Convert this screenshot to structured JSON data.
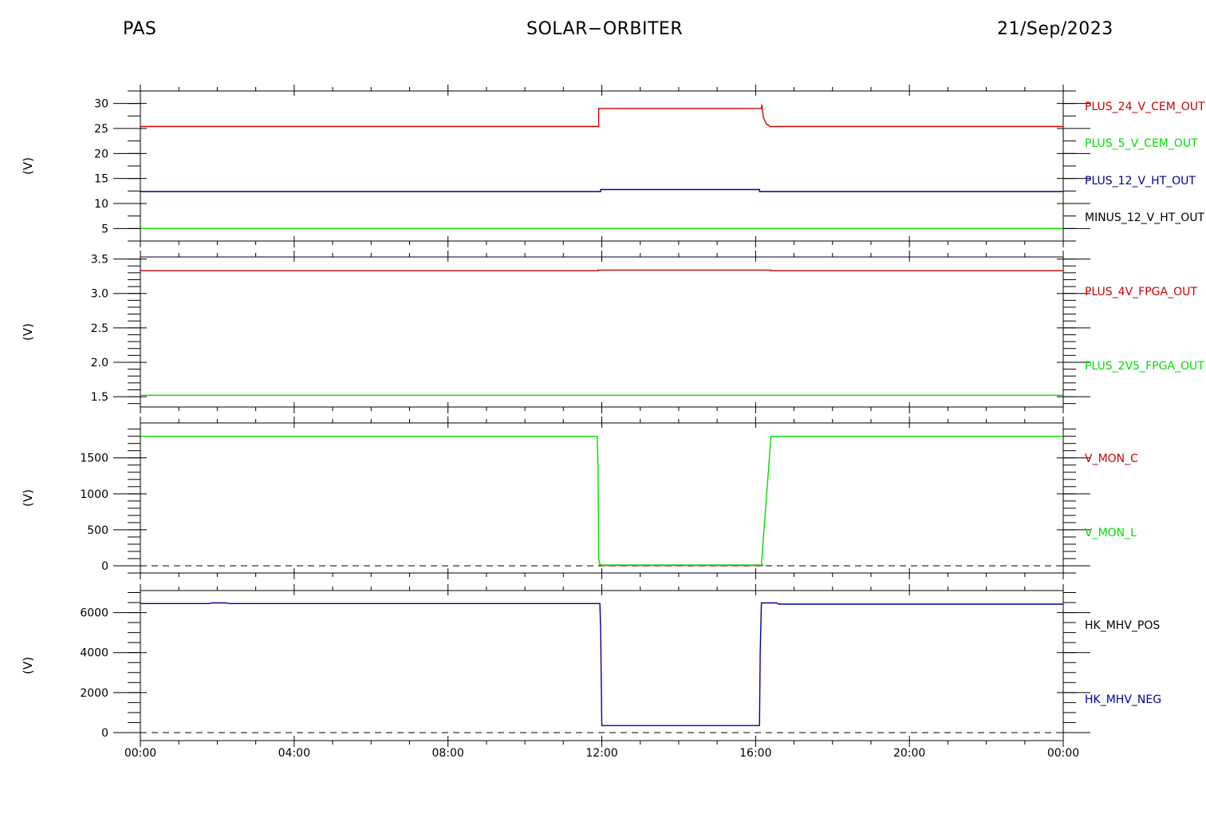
{
  "header": {
    "left": "PAS",
    "center": "SOLAR−ORBITER",
    "right": "21/Sep/2023"
  },
  "chart_data": [
    {
      "type": "line",
      "ylabel": "(V)",
      "ylim": [
        2.5,
        32.5
      ],
      "yticks": [
        5,
        10,
        15,
        20,
        25,
        30
      ],
      "ytick_labels": [
        "5",
        "10",
        "15",
        "20",
        "25",
        "30"
      ],
      "x_unit": "hours",
      "xlim": [
        0,
        24
      ],
      "legend_placement": "right",
      "series": [
        {
          "name": "PLUS_24_V_CEM_OUT",
          "color": "#cc0000",
          "x": [
            0,
            11.92,
            11.92,
            16.15,
            16.16,
            16.2,
            16.28,
            16.38,
            24
          ],
          "y": [
            25.4,
            25.4,
            29.0,
            29.0,
            29.8,
            27.2,
            25.9,
            25.4,
            25.4
          ]
        },
        {
          "name": "PLUS_5_V_CEM_OUT",
          "color": "#00dd00",
          "x": [
            0,
            24
          ],
          "y": [
            5.0,
            5.0
          ]
        },
        {
          "name": "PLUS_12_V_HT_OUT",
          "color": "#000099",
          "x": [
            0,
            11.97,
            11.97,
            16.1,
            16.1,
            24
          ],
          "y": [
            12.4,
            12.4,
            12.8,
            12.8,
            12.4,
            12.4
          ]
        },
        {
          "name": "MINUS_12_V_HT_OUT",
          "color": "#000000",
          "x": [],
          "y": []
        }
      ]
    },
    {
      "type": "line",
      "ylabel": "(V)",
      "ylim": [
        1.35,
        3.53
      ],
      "yticks": [
        1.5,
        2.0,
        2.5,
        3.0,
        3.5
      ],
      "ytick_labels": [
        "1.5",
        "2.0",
        "2.5",
        "3.0",
        "3.5"
      ],
      "x_unit": "hours",
      "xlim": [
        0,
        24
      ],
      "legend_placement": "right",
      "series": [
        {
          "name": "PLUS_4V_FPGA_OUT",
          "color": "#cc0000",
          "x": [
            0,
            11.9,
            11.9,
            16.4,
            16.4,
            24
          ],
          "y": [
            3.33,
            3.33,
            3.34,
            3.34,
            3.33,
            3.33
          ]
        },
        {
          "name": "PLUS_2V5_FPGA_OUT",
          "color": "#00dd00",
          "x": [
            0,
            24
          ],
          "y": [
            1.52,
            1.52
          ]
        }
      ]
    },
    {
      "type": "line",
      "ylabel": "(V)",
      "ylim": [
        -100,
        1985
      ],
      "yticks": [
        0,
        500,
        1000,
        1500
      ],
      "ytick_labels": [
        "0",
        "500",
        "1000",
        "1500"
      ],
      "x_unit": "hours",
      "xlim": [
        0,
        24
      ],
      "zero_line": 0,
      "legend_placement": "right",
      "series": [
        {
          "name": "V_MON_C",
          "color": "#cc0000",
          "x": [
            11.92,
            12.0,
            16.1,
            16.2
          ],
          "y": [
            5,
            5,
            5,
            5
          ]
        },
        {
          "name": "V_MON_L",
          "color": "#00dd00",
          "x": [
            0,
            11.88,
            11.9,
            11.92,
            11.95,
            12.0,
            16.1,
            16.15,
            16.4,
            16.42,
            24
          ],
          "y": [
            1800,
            1800,
            1400,
            100,
            20,
            10,
            10,
            10,
            1800,
            1800,
            1800
          ]
        }
      ]
    },
    {
      "type": "line",
      "ylabel": "(V)",
      "ylim": [
        -400,
        7100
      ],
      "yticks": [
        0,
        2000,
        4000,
        6000
      ],
      "ytick_labels": [
        "0",
        "2000",
        "4000",
        "6000"
      ],
      "x_unit": "hours",
      "xlim": [
        0,
        24
      ],
      "zero_line": 0,
      "xticks": [
        0,
        4,
        8,
        12,
        16,
        20,
        24
      ],
      "xtick_labels": [
        "00:00",
        "04:00",
        "08:00",
        "12:00",
        "16:00",
        "20:00",
        "00:00"
      ],
      "legend_placement": "right",
      "series": [
        {
          "name": "HK_MHV_POS",
          "color": "#000000",
          "x": [],
          "y": []
        },
        {
          "name": "HK_MHV_NEG",
          "color": "#000099",
          "x": [
            0,
            1.8,
            1.85,
            2.25,
            2.3,
            11.95,
            11.97,
            12.0,
            16.1,
            16.12,
            16.15,
            16.55,
            16.6,
            24
          ],
          "y": [
            6450,
            6450,
            6480,
            6480,
            6450,
            6450,
            5000,
            350,
            350,
            4000,
            6480,
            6480,
            6420,
            6420
          ]
        }
      ]
    }
  ]
}
